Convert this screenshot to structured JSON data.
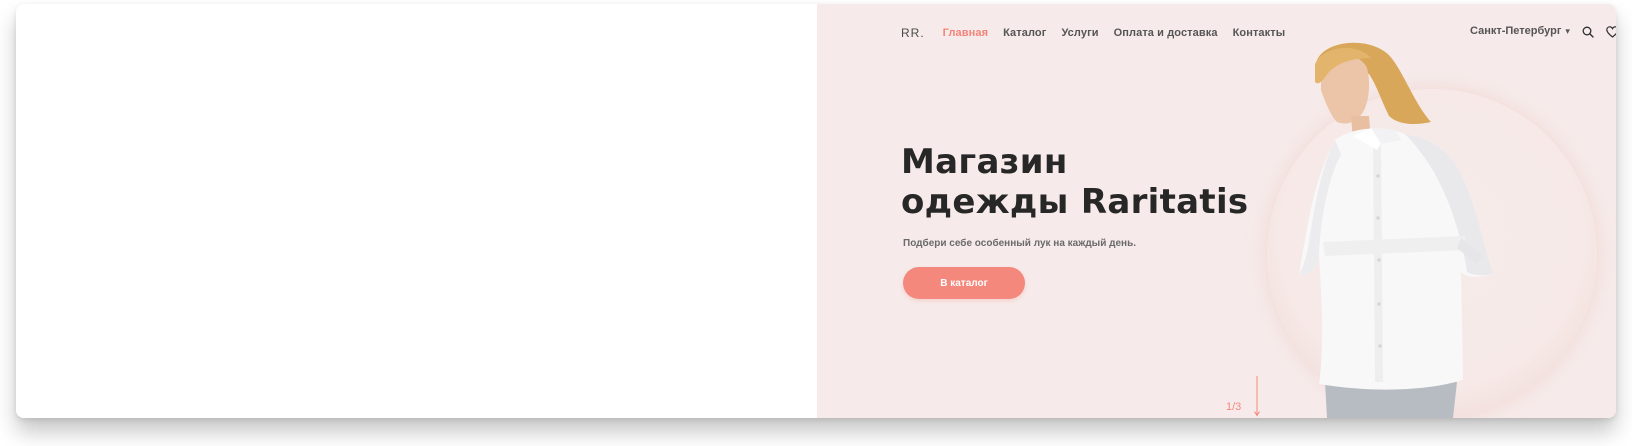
{
  "header": {
    "logo": "RR.",
    "nav": [
      {
        "label": "Главная",
        "active": true
      },
      {
        "label": "Каталог",
        "active": false
      },
      {
        "label": "Услуги",
        "active": false
      },
      {
        "label": "Оплата и доставка",
        "active": false
      },
      {
        "label": "Контакты",
        "active": false
      }
    ],
    "city": "Санкт-Петербург",
    "city_caret": "▾",
    "icons": [
      "search-icon",
      "heart-icon"
    ]
  },
  "hero": {
    "title_line1": "Магазин",
    "title_line2": "одежды Raritatis",
    "subtitle": "Подбери себе особенный лук на каждый день.",
    "cta_label": "В каталог",
    "pager": "1/3"
  },
  "colors": {
    "accent": "#f4887c",
    "hero_background": "#f6ebea",
    "text_dark": "#272727",
    "nav_text": "#555555"
  }
}
